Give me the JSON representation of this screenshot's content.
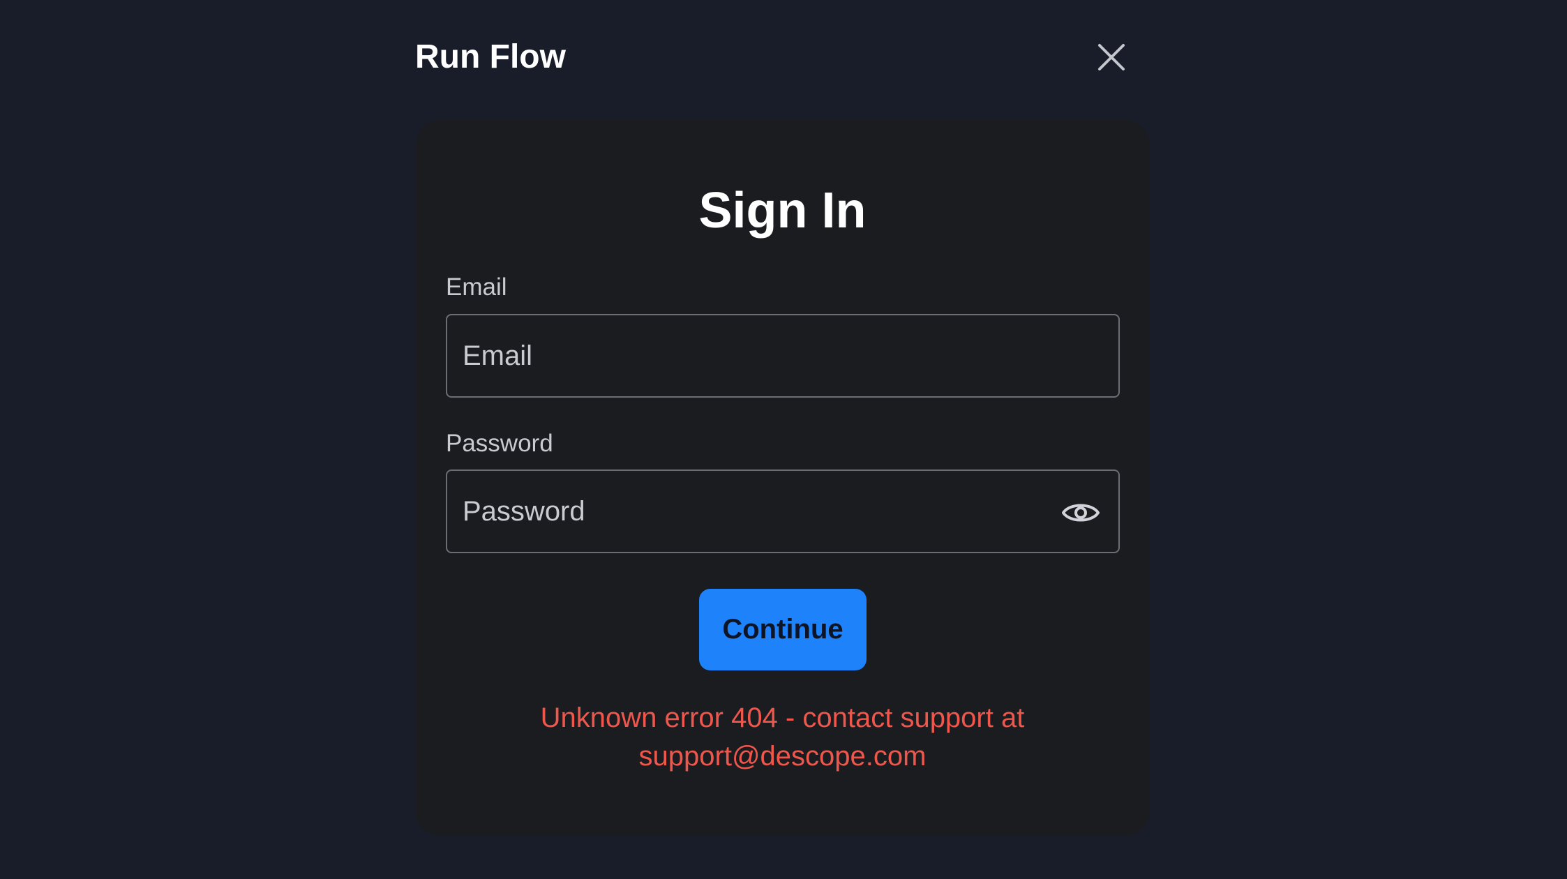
{
  "modal": {
    "title": "Run Flow",
    "close_icon": "close-icon"
  },
  "signin": {
    "title": "Sign In",
    "email": {
      "label": "Email",
      "placeholder": "Email",
      "value": ""
    },
    "password": {
      "label": "Password",
      "placeholder": "Password",
      "value": "",
      "toggle_icon": "eye-icon"
    },
    "continue_label": "Continue",
    "error": {
      "line1": "Unknown error 404 - contact support at",
      "line2": "support@descope.com"
    }
  },
  "colors": {
    "background": "#181d29",
    "card": "#1b1c20",
    "primary": "#1e82fa",
    "error": "#f0574c"
  }
}
